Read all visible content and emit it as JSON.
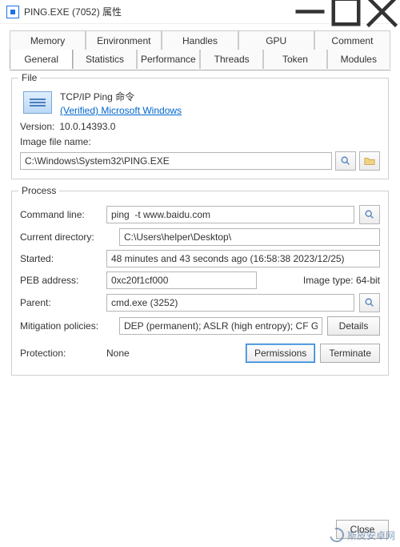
{
  "window": {
    "title": "PING.EXE (7052) 属性"
  },
  "tabs": {
    "top": [
      "Memory",
      "Environment",
      "Handles",
      "GPU",
      "Comment"
    ],
    "bottom": [
      "General",
      "Statistics",
      "Performance",
      "Threads",
      "Token",
      "Modules"
    ],
    "active": "General"
  },
  "file": {
    "group": "File",
    "description": "TCP/IP Ping 命令",
    "verified": "(Verified) Microsoft Windows",
    "version_label": "Version:",
    "version": "10.0.14393.0",
    "imagefile_label": "Image file name:",
    "path": "C:\\Windows\\System32\\PING.EXE"
  },
  "process": {
    "group": "Process",
    "cmd_label": "Command line:",
    "cmd": "ping  -t www.baidu.com",
    "curdir_label": "Current directory:",
    "curdir": "C:\\Users\\helper\\Desktop\\",
    "started_label": "Started:",
    "started": "48 minutes and 43 seconds ago (16:58:38 2023/12/25)",
    "peb_label": "PEB address:",
    "peb": "0xc20f1cf000",
    "imgtype_label": "Image type:",
    "imgtype": "64-bit",
    "parent_label": "Parent:",
    "parent": "cmd.exe (3252)",
    "mitig_label": "Mitigation policies:",
    "mitig": "DEP (permanent); ASLR (high entropy); CF Guard",
    "details_btn": "Details",
    "protection_label": "Protection:",
    "protection": "None",
    "permissions_btn": "Permissions",
    "terminate_btn": "Terminate"
  },
  "footer": {
    "close": "Close"
  },
  "watermark": "斯皮安卓网"
}
